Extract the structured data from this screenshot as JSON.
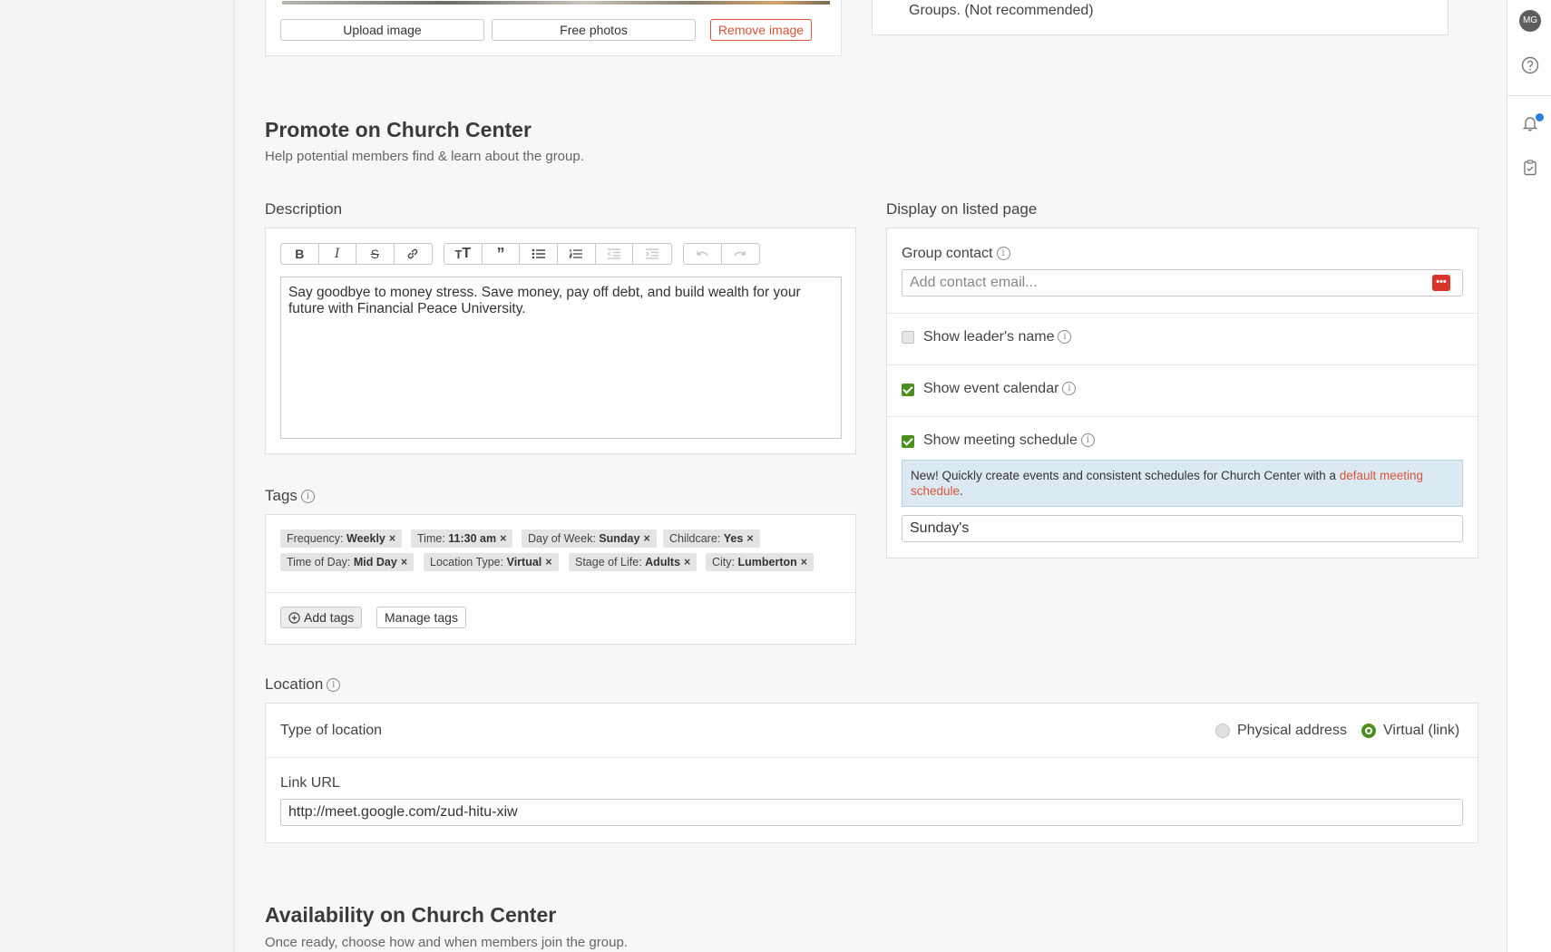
{
  "image_card": {
    "upload_label": "Upload image",
    "free_photos_label": "Free photos",
    "remove_label": "Remove image"
  },
  "groups_note": "Groups. (Not recommended)",
  "promote": {
    "title": "Promote on Church Center",
    "subtitle": "Help potential members find & learn about the group."
  },
  "description": {
    "label": "Description",
    "toolbar": {
      "format_icons": [
        "bold-icon",
        "italic-icon",
        "strikethrough-icon",
        "link-icon"
      ],
      "block_icons": [
        "heading-icon",
        "quote-icon",
        "bullet-list-icon",
        "numbered-list-icon",
        "outdent-icon",
        "indent-icon"
      ],
      "history_icons": [
        "undo-icon",
        "redo-icon"
      ]
    },
    "text": "Say goodbye to money stress. Save money, pay off debt, and build wealth for your future with Financial Peace University."
  },
  "tags": {
    "label": "Tags",
    "items": [
      {
        "key": "Frequency:",
        "value": "Weekly"
      },
      {
        "key": "Time:",
        "value": "11:30 am"
      },
      {
        "key": "Day of Week:",
        "value": "Sunday"
      },
      {
        "key": "Childcare:",
        "value": "Yes"
      },
      {
        "key": "Time of Day:",
        "value": "Mid Day"
      },
      {
        "key": "Location Type:",
        "value": "Virtual"
      },
      {
        "key": "Stage of Life:",
        "value": "Adults"
      },
      {
        "key": "City:",
        "value": "Lumberton"
      }
    ],
    "remove_glyph": "×",
    "add_label": "Add tags",
    "manage_label": "Manage tags"
  },
  "display": {
    "label": "Display on listed page",
    "group_contact_label": "Group contact",
    "contact_placeholder": "Add contact email...",
    "show_leader_label": "Show leader's name",
    "show_leader_checked": false,
    "show_calendar_label": "Show event calendar",
    "show_calendar_checked": true,
    "show_schedule_label": "Show meeting schedule",
    "show_schedule_checked": true,
    "notice_text": "New! Quickly create events and consistent schedules for Church Center with a ",
    "notice_link": "default meeting schedule",
    "notice_end": ".",
    "schedule_value": "Sunday's"
  },
  "location": {
    "label": "Location",
    "type_label": "Type of location",
    "physical_label": "Physical address",
    "virtual_label": "Virtual (link)",
    "selected": "Virtual (link)",
    "link_label": "Link URL",
    "link_value": "http://meet.google.com/zud-hitu-xiw"
  },
  "availability": {
    "title": "Availability on Church Center",
    "subtitle": "Once ready, choose how and when members join the group."
  },
  "rail": {
    "avatar_initials": "MG",
    "icons": [
      "help-icon",
      "bell-icon",
      "clipboard-check-icon"
    ]
  },
  "colors": {
    "accent_green": "#4c8f1e",
    "link_red": "#d8543a",
    "notification_blue": "#2a7de1"
  }
}
